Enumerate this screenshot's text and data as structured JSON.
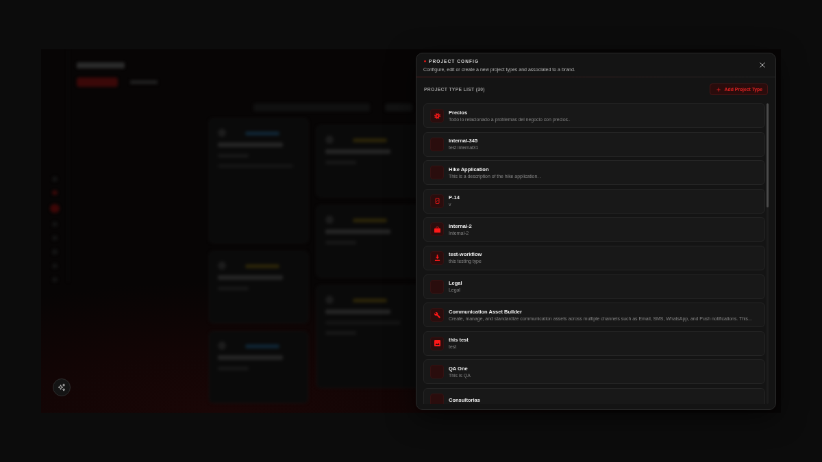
{
  "dialog": {
    "title": "PROJECT CONFIG",
    "subtitle": "Configure, edit or create a new project types and associated to a brand.",
    "list_heading": "PROJECT TYPE LIST (30)",
    "add_button": "Add Project Type",
    "project_types": [
      {
        "kind": "gear",
        "name": "Precios",
        "description": "Todo lo relacionado a problemas del negocio con precios.."
      },
      {
        "kind": "blank",
        "name": "Internal-345",
        "description": "test internal31"
      },
      {
        "kind": "blank",
        "name": "Hike Application",
        "description": "This is a description of the hike application. ."
      },
      {
        "kind": "phone",
        "name": "P-14",
        "description": "v"
      },
      {
        "kind": "briefcase",
        "name": "Internal-2",
        "description": "Internal-2"
      },
      {
        "kind": "download",
        "name": "test-workflow",
        "description": "this testing type"
      },
      {
        "kind": "blank",
        "name": "Legal",
        "description": "Legal"
      },
      {
        "kind": "wrench",
        "name": "Communication Asset Builder",
        "description": "Create, manage, and standardize communication assets across multiple channels such as Email, SMS, WhatsApp, and Push notifications. This..."
      },
      {
        "kind": "image",
        "name": "this test",
        "description": "test"
      },
      {
        "kind": "blank",
        "name": "QA One",
        "description": "This is QA"
      },
      {
        "kind": "blank",
        "name": "Consultorias"
      }
    ]
  }
}
